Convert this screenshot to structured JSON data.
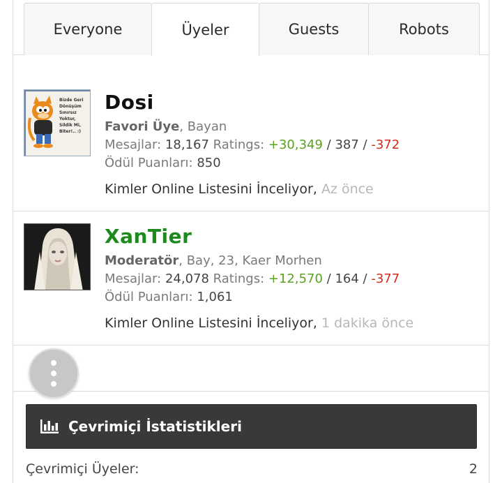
{
  "tabs": [
    {
      "label": "Everyone",
      "active": false
    },
    {
      "label": "Üyeler",
      "active": true
    },
    {
      "label": "Guests",
      "active": false
    },
    {
      "label": "Robots",
      "active": false
    }
  ],
  "members": [
    {
      "name": "Dosi",
      "name_color": "#111111",
      "avatar_text": "Bizde Geri Dönüşüm Sınırsız Yoktur, Sildik Mi, Biter!.. :)",
      "role": "Favori Üye",
      "details": ", Bayan",
      "messages_label": "Mesajlar:",
      "messages": "18,167",
      "ratings_label": "Ratings:",
      "ratings_positive": "+30,349",
      "ratings_sep1": " / ",
      "ratings_neutral": "387",
      "ratings_sep2": " / ",
      "ratings_negative": "-372",
      "points_label": "Ödül Puanları:",
      "points": "850",
      "activity": "Kimler Online Listesini İnceliyor,",
      "activity_time": "Az önce"
    },
    {
      "name": "XanTier",
      "name_color": "#1e8a1e",
      "role": "Moderatör",
      "details": ", Bay, 23, Kaer Morhen",
      "messages_label": "Mesajlar:",
      "messages": "24,078",
      "ratings_label": "Ratings:",
      "ratings_positive": "+12,570",
      "ratings_sep1": " / ",
      "ratings_neutral": "164",
      "ratings_sep2": " / ",
      "ratings_negative": "-377",
      "points_label": "Ödül Puanları:",
      "points": "1,061",
      "activity": "Kimler Online Listesini İnceliyor,",
      "activity_time": "1 dakika önce"
    }
  ],
  "fab": {
    "icon": "vertical-ellipsis-icon"
  },
  "stats": {
    "title": "Çevrimiçi İstatistikleri",
    "icon": "bar-chart-icon",
    "rows": [
      {
        "label": "Çevrimiçi Üyeler:",
        "value": "2"
      }
    ]
  },
  "colors": {
    "moderator": "#1e8a1e",
    "positive": "#5aa11c",
    "negative": "#d52a1b",
    "header_bg": "#393939"
  }
}
